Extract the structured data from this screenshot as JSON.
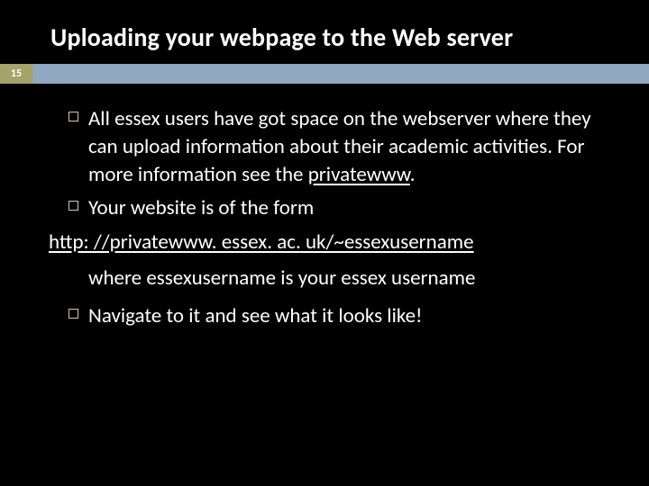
{
  "slide": {
    "title": "Uploading your webpage to the Web server",
    "page_number": "15",
    "bullets": [
      {
        "pre": "All essex users have got space on the webserver where they can upload information about their academic activities. For more information see the ",
        "link": "privatewww",
        "post": "."
      },
      {
        "text": "Your website is of the form"
      }
    ],
    "url_line": "http: //privatewww. essex. ac. uk/~essexusername",
    "sub_line": "where essexusername is your essex username",
    "bullets2": [
      {
        "text": "Navigate to it and see what it looks like!"
      }
    ]
  }
}
